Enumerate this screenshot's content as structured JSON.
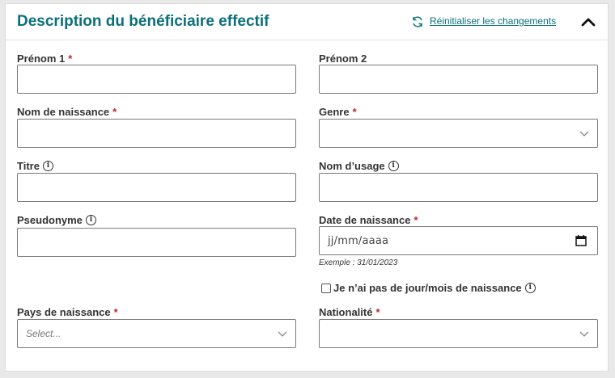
{
  "section": {
    "title": "Description du bénéficiaire effectif",
    "reset_label": "Réinitialiser les changements"
  },
  "colors": {
    "accent": "#0b6f7a",
    "required": "#c0262d"
  },
  "fields": {
    "prenom1": {
      "label": "Prénom 1",
      "required_mark": "*",
      "value": ""
    },
    "prenom2": {
      "label": "Prénom 2",
      "value": ""
    },
    "nom_naissance": {
      "label": "Nom de naissance",
      "required_mark": "*",
      "value": ""
    },
    "genre": {
      "label": "Genre",
      "required_mark": "*",
      "value": ""
    },
    "titre": {
      "label": "Titre",
      "info": "i",
      "value": ""
    },
    "nom_usage": {
      "label": "Nom d’usage",
      "info": "i",
      "value": ""
    },
    "pseudonyme": {
      "label": "Pseudonyme",
      "info": "i",
      "value": ""
    },
    "date_naissance": {
      "label": "Date de naissance",
      "required_mark": "*",
      "placeholder": "jj/mm/aaaa",
      "hint": "Exemple : 31/01/2023"
    },
    "no_day_month": {
      "label": "Je n’ai pas de jour/mois de naissance",
      "info": "i",
      "checked": false
    },
    "pays_naissance": {
      "label": "Pays de naissance",
      "required_mark": "*",
      "placeholder": "Select..."
    },
    "nationalite": {
      "label": "Nationalité",
      "required_mark": "*",
      "value": ""
    }
  }
}
